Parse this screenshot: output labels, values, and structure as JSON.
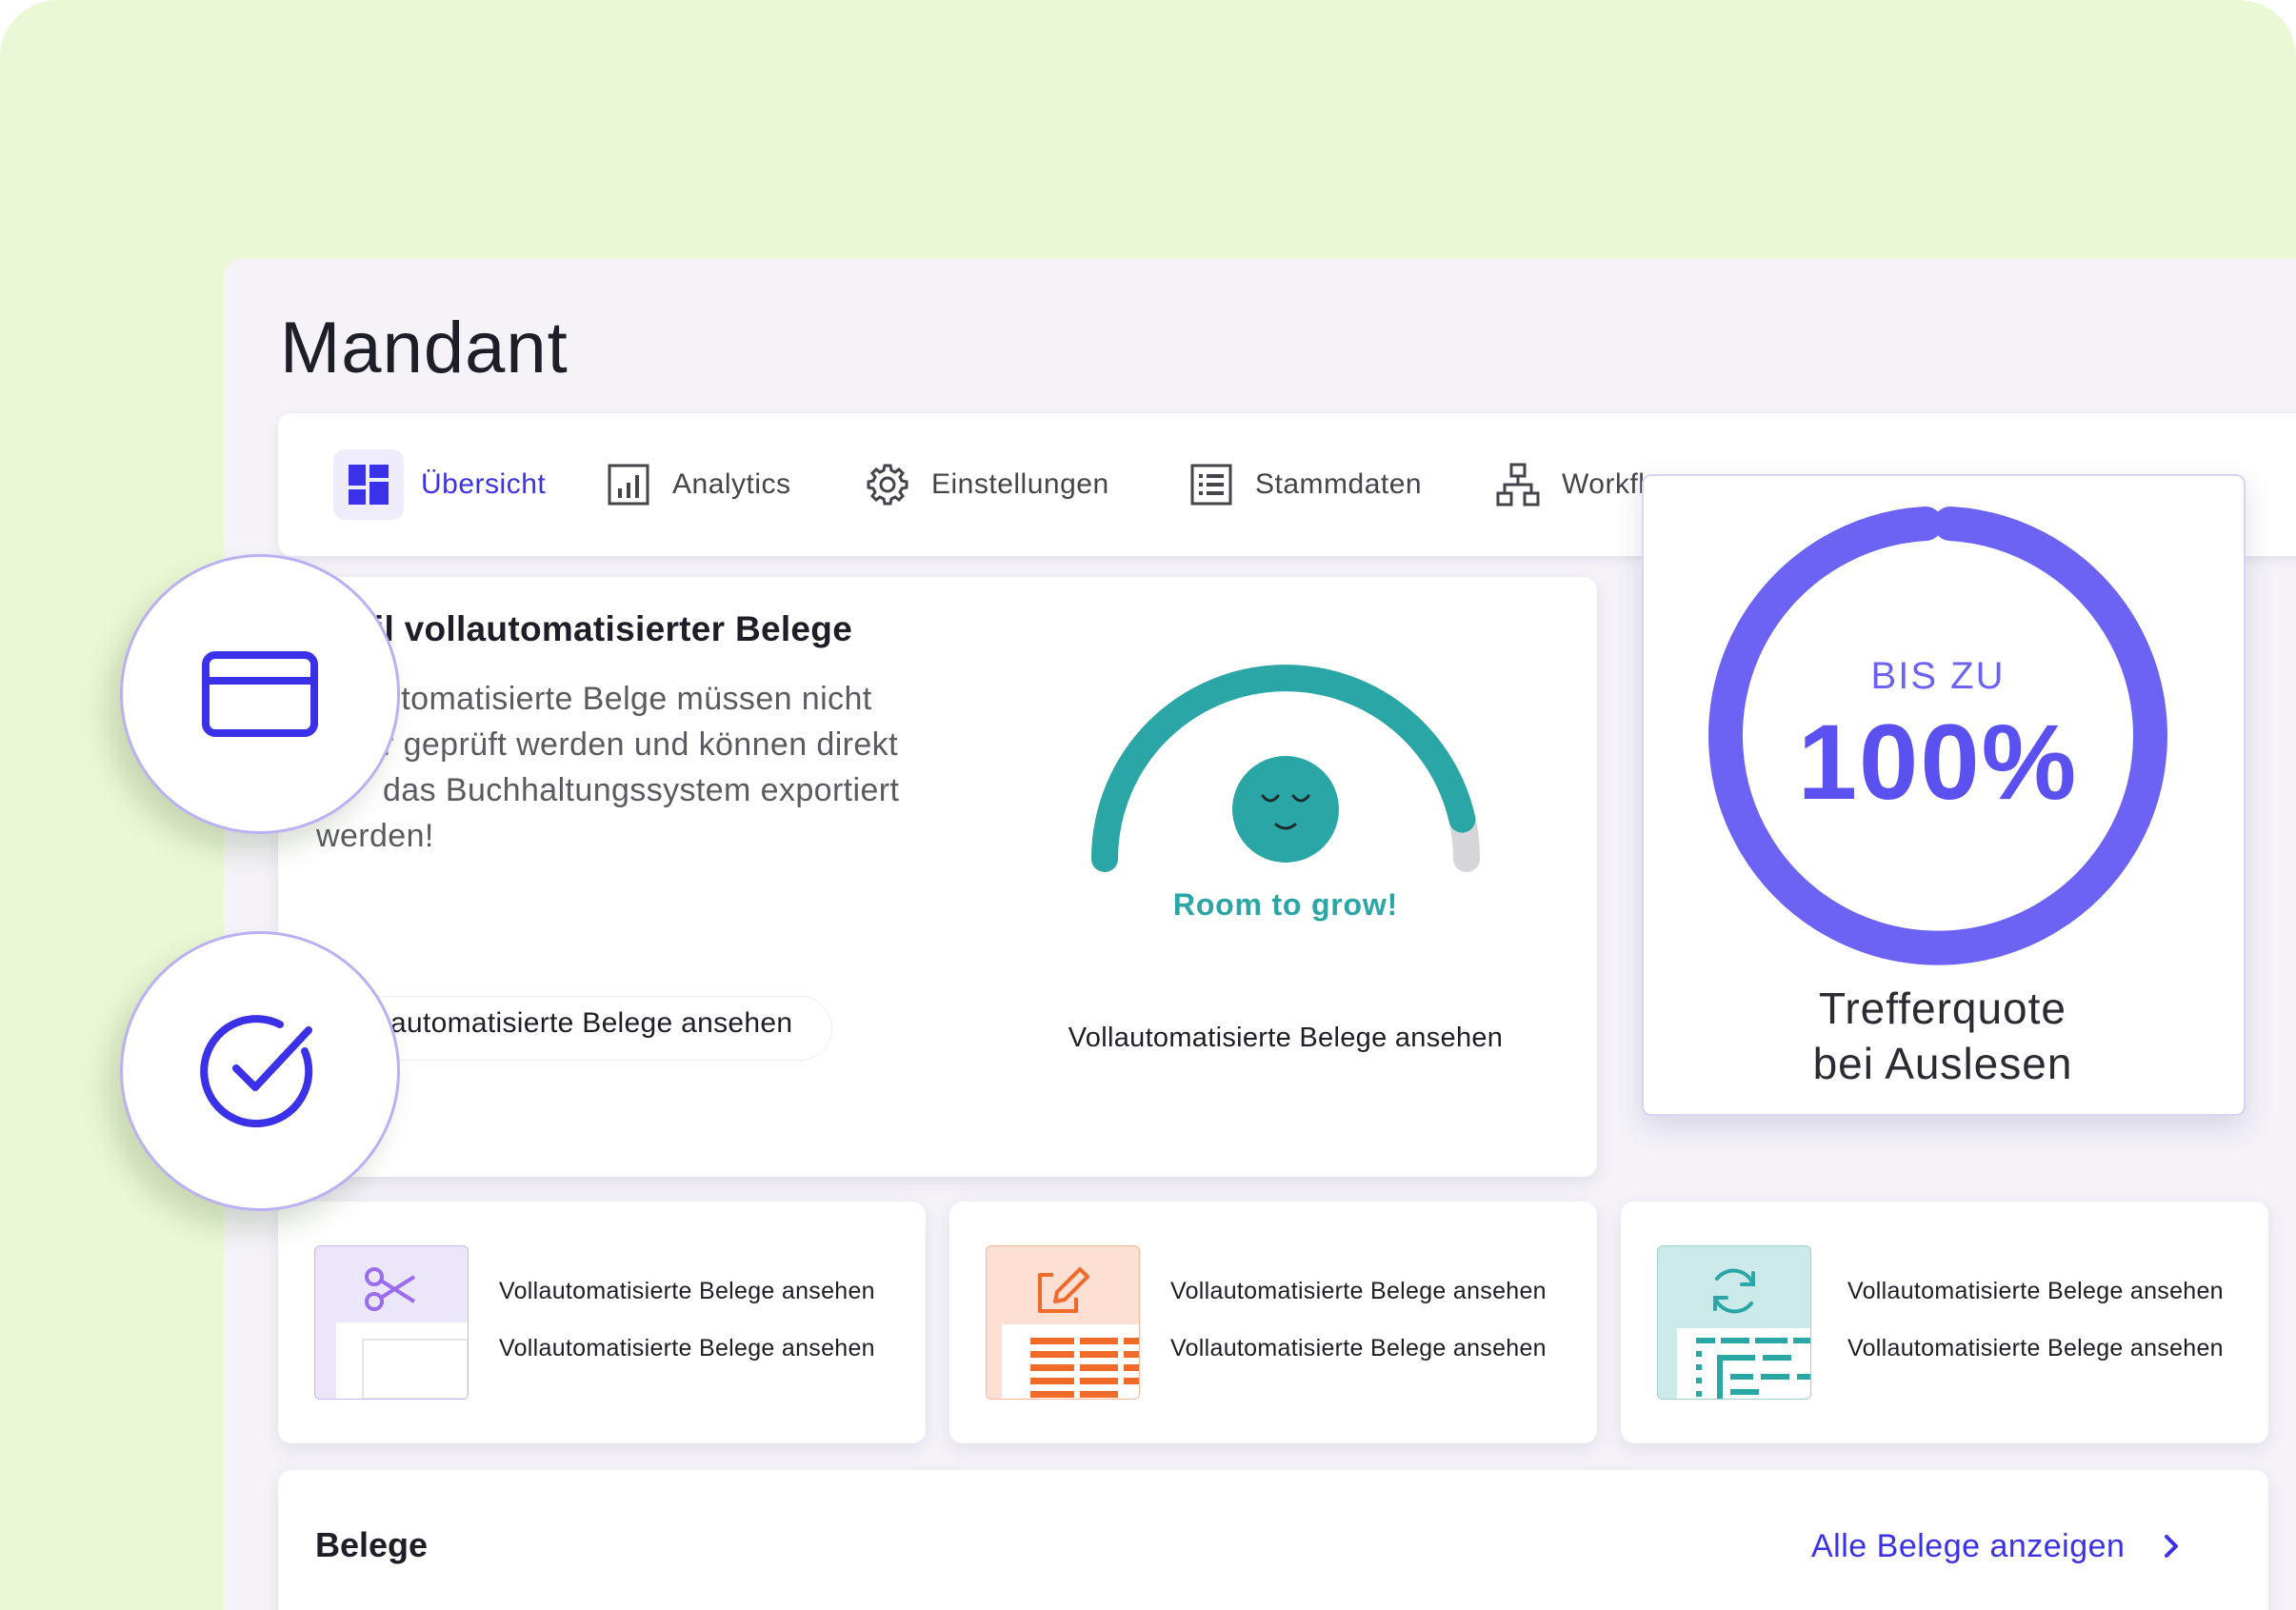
{
  "page": {
    "title": "Mandant"
  },
  "tabs": [
    {
      "label": "Übersicht",
      "icon": "dashboard-icon",
      "active": true
    },
    {
      "label": "Analytics",
      "icon": "bar-chart-icon",
      "active": false
    },
    {
      "label": "Einstellungen",
      "icon": "gear-icon",
      "active": false
    },
    {
      "label": "Stammdaten",
      "icon": "list-icon",
      "active": false
    },
    {
      "label": "Workfl",
      "icon": "workflow-icon",
      "active": false
    }
  ],
  "main_card": {
    "title": "eil vollautomatisierter Belege",
    "description_lines": [
      "utomatisierte Belge müssen nicht",
      "r geprüft werden und können direkt",
      "das Buchhaltungssystem exportiert",
      "werden!"
    ],
    "button_label": "automatisierte Belege ansehen",
    "gauge": {
      "fraction": 0.93,
      "caption": "Room to grow!",
      "icon": "sleeping-face-icon"
    },
    "gauge_link": "Vollautomatisierte Belege ansehen"
  },
  "hit_rate": {
    "upper_label": "BIS ZU",
    "value": "100%",
    "caption_line1": "Trefferquote",
    "caption_line2": "bei Auslesen",
    "color": "#6c63f5"
  },
  "small_cards": [
    {
      "icon": "scissors-icon",
      "color": "#9b6cf0",
      "lines": [
        "Vollautomatisierte Belege ansehen",
        "Vollautomatisierte Belege ansehen"
      ]
    },
    {
      "icon": "edit-icon",
      "color": "#f06a2a",
      "lines": [
        "Vollautomatisierte Belege ansehen",
        "Vollautomatisierte Belege ansehen"
      ]
    },
    {
      "icon": "sync-icon",
      "color": "#2aa6a6",
      "lines": [
        "Vollautomatisierte Belege ansehen",
        "Vollautomatisierte Belege ansehen"
      ]
    }
  ],
  "belege": {
    "title": "Belege",
    "link_label": "Alle Belege anzeigen"
  },
  "badges": [
    {
      "icon": "credit-card-icon"
    },
    {
      "icon": "checkmark-circle-icon"
    }
  ],
  "colors": {
    "background": "#ebf8d6",
    "accent": "#3b31e8",
    "teal": "#2aa6a6",
    "ring": "#6c63f5"
  }
}
